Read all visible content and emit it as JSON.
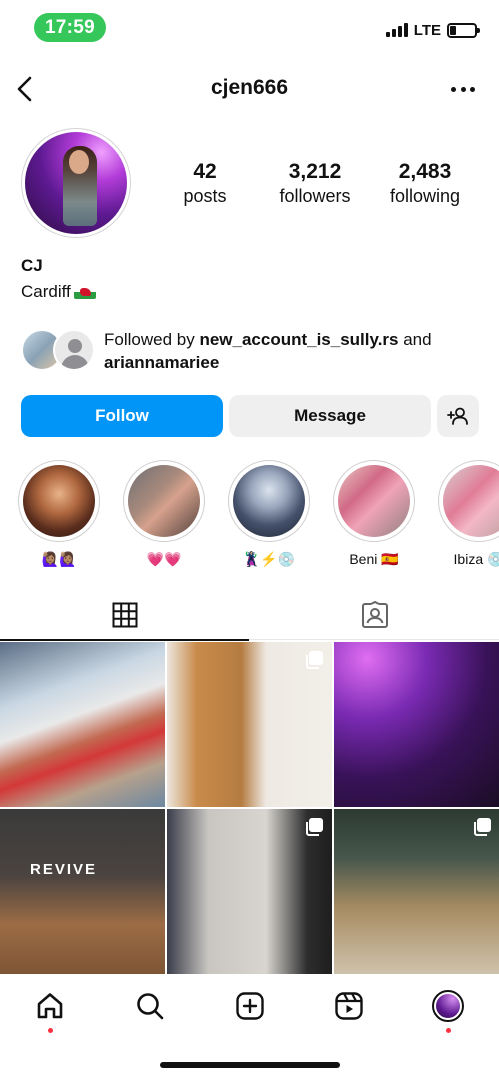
{
  "status_bar": {
    "time": "17:59",
    "network": "LTE",
    "battery_level": 0.25
  },
  "header": {
    "back_icon": "chevron-left-icon",
    "username": "cjen666",
    "more_icon": "more-horizontal-icon"
  },
  "profile": {
    "stats": [
      {
        "value": "42",
        "label": "posts"
      },
      {
        "value": "3,212",
        "label": "followers"
      },
      {
        "value": "2,483",
        "label": "following"
      }
    ],
    "name": "CJ",
    "bio": "Cardiff",
    "bio_flag": "wales-flag-icon"
  },
  "followed_by": {
    "prefix": "Followed by ",
    "user1": "new_account_is_sully.rs",
    "connector": " and",
    "user2": "ariannamariee"
  },
  "actions": {
    "follow_label": "Follow",
    "message_label": "Message",
    "add_user_icon": "add-user-icon"
  },
  "highlights": [
    {
      "label": "🙋🏽‍♀️🙋🏽‍♀️"
    },
    {
      "label": "💗💗"
    },
    {
      "label": "🦹🏻‍♀️⚡️💿"
    },
    {
      "label": "Beni 🇪🇸"
    },
    {
      "label": "Ibiza 💿"
    }
  ],
  "tabs": {
    "grid_icon": "grid-icon",
    "tagged_icon": "tagged-icon",
    "active": "grid"
  },
  "posts": [
    {
      "multi": false
    },
    {
      "multi": true
    },
    {
      "multi": false
    },
    {
      "multi": false,
      "overlay_text": "REVIVE"
    },
    {
      "multi": true
    },
    {
      "multi": true
    }
  ],
  "bottom_nav": {
    "items": [
      "home-icon",
      "search-icon",
      "create-icon",
      "reels-icon",
      "profile-avatar"
    ]
  },
  "colors": {
    "accent": "#0095f6",
    "status_pill": "#35c759",
    "notification_dot": "#ff3040"
  }
}
